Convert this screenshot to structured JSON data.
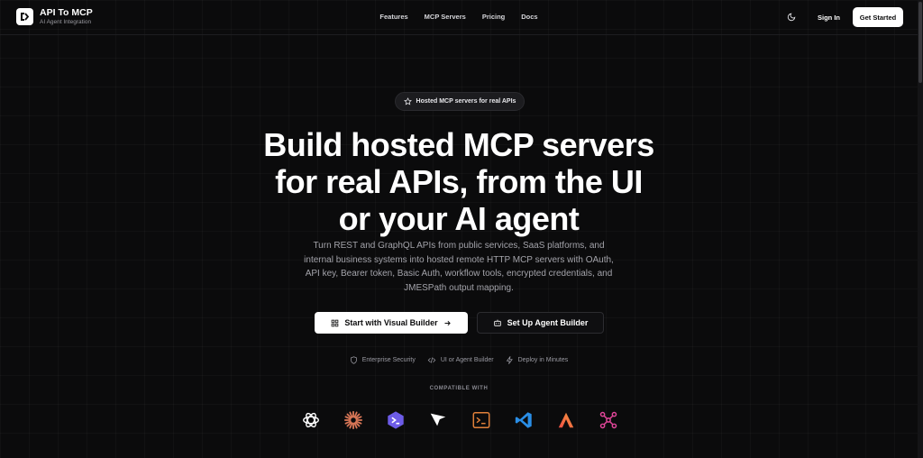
{
  "brand": {
    "title": "API To MCP",
    "subtitle": "AI Agent Integration"
  },
  "nav": {
    "items": [
      "Features",
      "MCP Servers",
      "Pricing",
      "Docs"
    ]
  },
  "header": {
    "sign_in": "Sign In",
    "get_started": "Get Started"
  },
  "hero": {
    "badge": "Hosted MCP servers for real APIs",
    "title_lines": [
      "Build hosted MCP servers",
      "for real APIs, from the UI",
      "or your AI agent"
    ],
    "description": "Turn REST and GraphQL APIs from public services, SaaS platforms, and internal business systems into hosted remote HTTP MCP servers with OAuth, API key, Bearer token, Basic Auth, workflow tools, encrypted credentials, and JMESPath output mapping.",
    "cta_primary": "Start with Visual Builder",
    "cta_secondary": "Set Up Agent Builder"
  },
  "features": [
    "Enterprise Security",
    "UI or Agent Builder",
    "Deploy in Minutes"
  ],
  "compatible": {
    "label": "COMPATIBLE WITH",
    "icons": [
      "openai-icon",
      "claude-icon",
      "prompt-terminal-icon",
      "cursor-icon",
      "terminal-icon",
      "vscode-icon",
      "windsurf-icon",
      "network-nodes-icon"
    ]
  },
  "colors": {
    "background": "#0b0b0c",
    "accent": "#ffffff",
    "muted": "#a3a3aa"
  }
}
